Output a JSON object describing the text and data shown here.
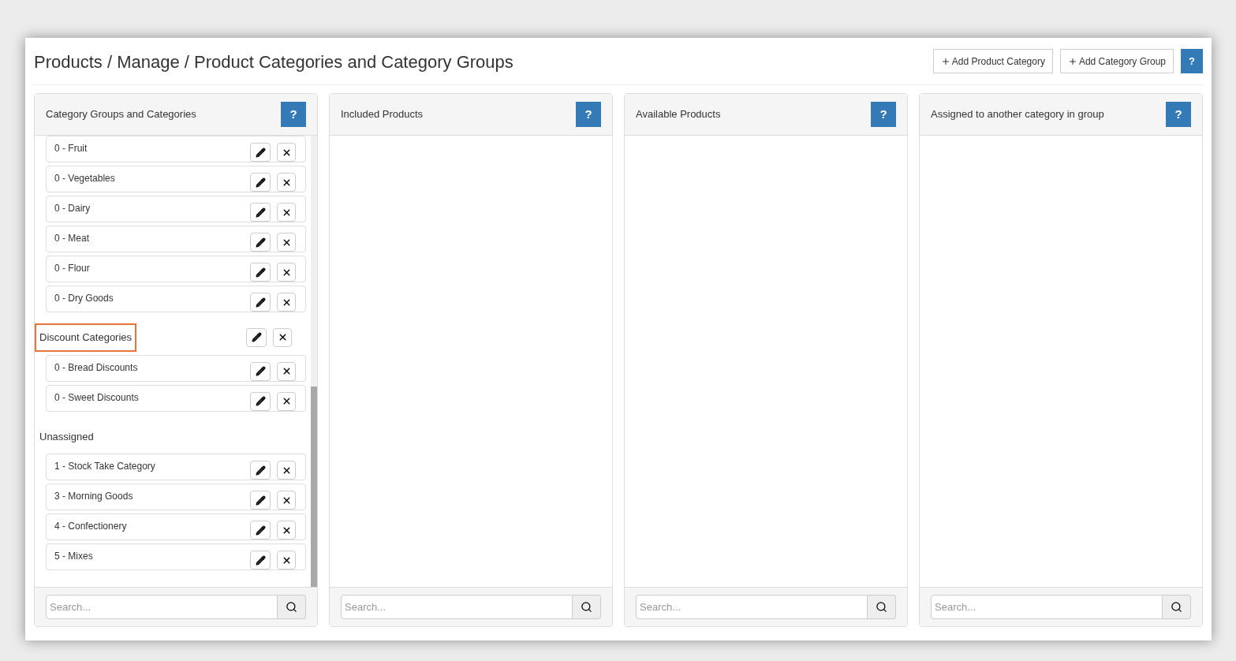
{
  "breadcrumb": "Products / Manage / Product Categories and Category Groups",
  "toolbar": {
    "buttons": [
      {
        "label": "Add Product Category"
      },
      {
        "label": "Add Category Group"
      }
    ],
    "help": "?"
  },
  "panels": [
    {
      "title": "Category Groups and Categories",
      "help": "?",
      "search_placeholder": "Search...",
      "groups": [
        {
          "items": [
            "0 - Fruit",
            "0 - Vegetables",
            "0 - Dairy",
            "0 - Meat",
            "0 - Flour",
            "0 - Dry Goods"
          ]
        },
        {
          "title": "Discount Categories",
          "editable": true,
          "highlighted": true,
          "items": [
            "0 - Bread Discounts",
            "0 - Sweet Discounts"
          ]
        },
        {
          "title": "Unassigned",
          "editable": false,
          "highlighted": false,
          "items": [
            "1 - Stock Take Category",
            "3 - Morning Goods",
            "4 - Confectionery",
            "5 - Mixes"
          ]
        }
      ]
    },
    {
      "title": "Included Products",
      "help": "?",
      "search_placeholder": "Search..."
    },
    {
      "title": "Available Products",
      "help": "?",
      "search_placeholder": "Search..."
    },
    {
      "title": "Assigned to another category in group",
      "help": "?",
      "search_placeholder": "Search..."
    }
  ]
}
